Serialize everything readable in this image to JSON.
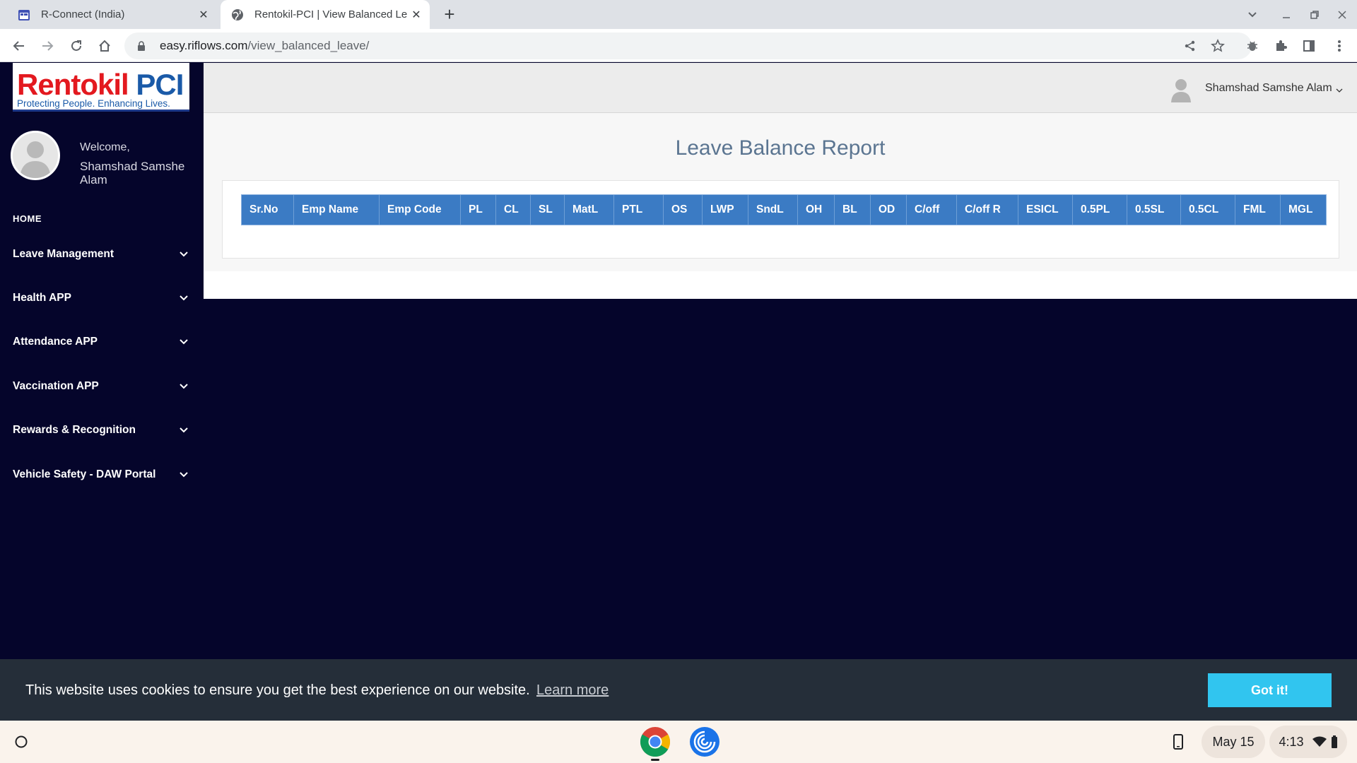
{
  "browser": {
    "tabs": [
      {
        "title": "R-Connect (India)"
      },
      {
        "title": "Rentokil-PCI | View Balanced Lea"
      }
    ],
    "url_host": "easy.riflows.com",
    "url_path": "/view_balanced_leave/"
  },
  "sidebar": {
    "logo_brand_1": "Rentokil",
    "logo_brand_2": "PCI",
    "logo_tagline": "Protecting People. Enhancing Lives.",
    "welcome": "Welcome,",
    "user_name": "Shamshad Samshe Alam",
    "home_label": "HOME",
    "items": [
      {
        "label": "Leave Management"
      },
      {
        "label": "Health APP"
      },
      {
        "label": "Attendance APP"
      },
      {
        "label": "Vaccination APP"
      },
      {
        "label": "Rewards & Recognition"
      },
      {
        "label": "Vehicle Safety - DAW Portal"
      }
    ]
  },
  "header": {
    "user_name": "Shamshad Samshe Alam"
  },
  "report": {
    "title": "Leave Balance Report",
    "columns": [
      "Sr.No",
      "Emp Name",
      "Emp Code",
      "PL",
      "CL",
      "SL",
      "MatL",
      "PTL",
      "OS",
      "LWP",
      "SndL",
      "OH",
      "BL",
      "OD",
      "C/off",
      "C/off R",
      "ESICL",
      "0.5PL",
      "0.5SL",
      "0.5CL",
      "FML",
      "MGL"
    ]
  },
  "cookie": {
    "message": "This website uses cookies to ensure you get the best experience on our website.",
    "link": "Learn more",
    "button": "Got it!"
  },
  "shelf": {
    "date": "May 15",
    "time": "4:13"
  },
  "colors": {
    "sidebar_bg": "#05052b",
    "table_header_bg": "#3b7bc4",
    "cookie_button": "#31c5ef",
    "title_color": "#5b7591"
  }
}
